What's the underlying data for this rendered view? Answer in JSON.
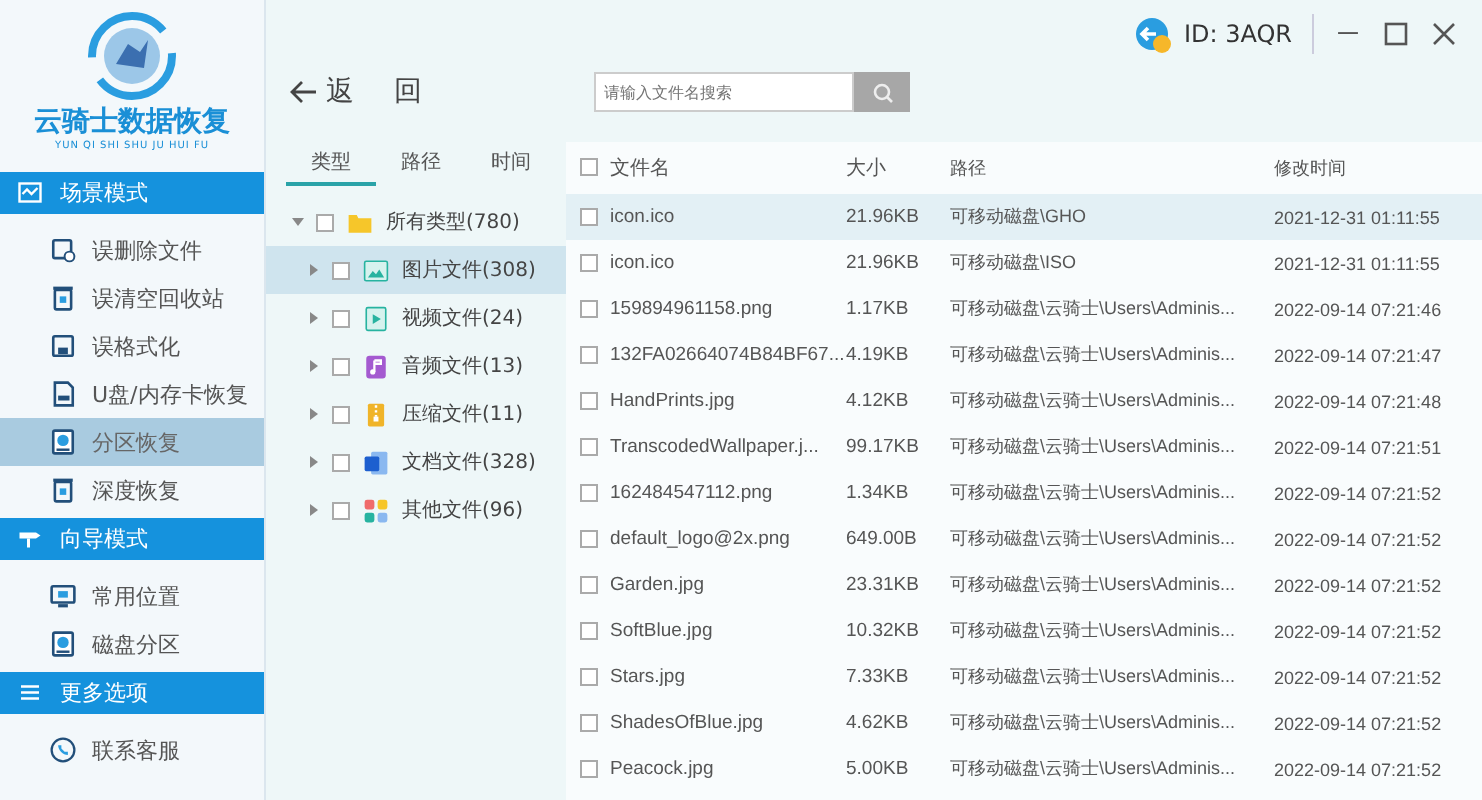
{
  "app": {
    "title": "云骑士数据恢复",
    "subtitle": "YUN QI SHI SHU JU HUI FU"
  },
  "sidebar": {
    "sections": [
      {
        "title": "场景模式",
        "items": [
          {
            "label": "误删除文件",
            "selected": false
          },
          {
            "label": "误清空回收站",
            "selected": false
          },
          {
            "label": "误格式化",
            "selected": false
          },
          {
            "label": "U盘/内存卡恢复",
            "selected": false
          },
          {
            "label": "分区恢复",
            "selected": true
          },
          {
            "label": "深度恢复",
            "selected": false
          }
        ]
      },
      {
        "title": "向导模式",
        "items": [
          {
            "label": "常用位置",
            "selected": false
          },
          {
            "label": "磁盘分区",
            "selected": false
          }
        ]
      },
      {
        "title": "更多选项",
        "items": [
          {
            "label": "联系客服",
            "selected": false
          }
        ]
      }
    ]
  },
  "titlebar": {
    "id": "ID: 3AQR"
  },
  "toolbar": {
    "back": "返",
    "back2": "回",
    "search": {
      "placeholder": "请输入文件名搜索"
    }
  },
  "tabs": [
    {
      "label": "类型",
      "selected": true
    },
    {
      "label": "路径",
      "selected": false
    },
    {
      "label": "时间",
      "selected": false
    }
  ],
  "tree": [
    {
      "label": "所有类型(780)",
      "expanded": true,
      "checked": false,
      "selected": false,
      "children": [
        {
          "label": "图片文件(308)",
          "expanded": false,
          "checked": false,
          "selected": true
        },
        {
          "label": "视频文件(24)",
          "expanded": false,
          "checked": false,
          "selected": false
        },
        {
          "label": "音频文件(13)",
          "expanded": false,
          "checked": false,
          "selected": false
        },
        {
          "label": "压缩文件(11)",
          "expanded": false,
          "checked": false,
          "selected": false
        },
        {
          "label": "文档文件(328)",
          "expanded": false,
          "checked": false,
          "selected": false
        },
        {
          "label": "其他文件(96)",
          "expanded": false,
          "checked": false,
          "selected": false
        }
      ]
    }
  ],
  "table": {
    "columns": [
      "文件名",
      "大小",
      "路径",
      "修改时间"
    ],
    "all_checked": false,
    "rows": [
      {
        "name": "icon.ico",
        "size": "21.96KB",
        "path": "可移动磁盘\\GHO",
        "time": "2021-12-31 01:11:55",
        "checked": false,
        "selected": true
      },
      {
        "name": "icon.ico",
        "size": "21.96KB",
        "path": "可移动磁盘\\ISO",
        "time": "2021-12-31 01:11:55",
        "checked": false,
        "selected": false
      },
      {
        "name": "159894961158.png",
        "size": "1.17KB",
        "path": "可移动磁盘\\云骑士\\Users\\Adminis...",
        "time": "2022-09-14 07:21:46",
        "checked": false,
        "selected": false
      },
      {
        "name": "132FA02664074B84BF67...",
        "size": "4.19KB",
        "path": "可移动磁盘\\云骑士\\Users\\Adminis...",
        "time": "2022-09-14 07:21:47",
        "checked": false,
        "selected": false
      },
      {
        "name": "HandPrints.jpg",
        "size": "4.12KB",
        "path": "可移动磁盘\\云骑士\\Users\\Adminis...",
        "time": "2022-09-14 07:21:48",
        "checked": false,
        "selected": false
      },
      {
        "name": "TranscodedWallpaper.j...",
        "size": "99.17KB",
        "path": "可移动磁盘\\云骑士\\Users\\Adminis...",
        "time": "2022-09-14 07:21:51",
        "checked": false,
        "selected": false
      },
      {
        "name": "162484547112.png",
        "size": "1.34KB",
        "path": "可移动磁盘\\云骑士\\Users\\Adminis...",
        "time": "2022-09-14 07:21:52",
        "checked": false,
        "selected": false
      },
      {
        "name": "default_logo@2x.png",
        "size": "649.00B",
        "path": "可移动磁盘\\云骑士\\Users\\Adminis...",
        "time": "2022-09-14 07:21:52",
        "checked": false,
        "selected": false
      },
      {
        "name": "Garden.jpg",
        "size": "23.31KB",
        "path": "可移动磁盘\\云骑士\\Users\\Adminis...",
        "time": "2022-09-14 07:21:52",
        "checked": false,
        "selected": false
      },
      {
        "name": "SoftBlue.jpg",
        "size": "10.32KB",
        "path": "可移动磁盘\\云骑士\\Users\\Adminis...",
        "time": "2022-09-14 07:21:52",
        "checked": false,
        "selected": false
      },
      {
        "name": "Stars.jpg",
        "size": "7.33KB",
        "path": "可移动磁盘\\云骑士\\Users\\Adminis...",
        "time": "2022-09-14 07:21:52",
        "checked": false,
        "selected": false
      },
      {
        "name": "ShadesOfBlue.jpg",
        "size": "4.62KB",
        "path": "可移动磁盘\\云骑士\\Users\\Adminis...",
        "time": "2022-09-14 07:21:52",
        "checked": false,
        "selected": false
      },
      {
        "name": "Peacock.jpg",
        "size": "5.00KB",
        "path": "可移动磁盘\\云骑士\\Users\\Adminis...",
        "time": "2022-09-14 07:21:52",
        "checked": false,
        "selected": false
      }
    ]
  }
}
